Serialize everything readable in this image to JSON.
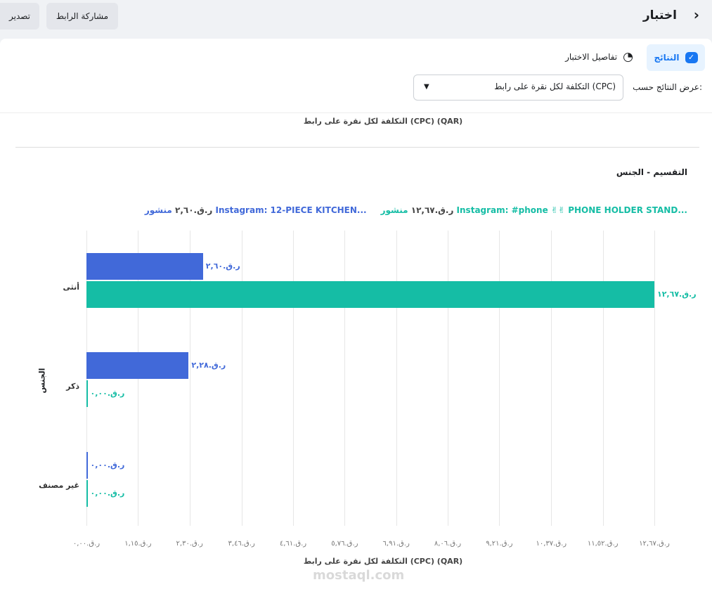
{
  "header": {
    "title": "اختبار",
    "share_label": "مشاركة الرابط",
    "export_label": "تصدير"
  },
  "tabs": [
    {
      "label": "النتائج",
      "active": true
    },
    {
      "label": "تفاصيل الاختبار"
    }
  ],
  "view_by": {
    "label": "عرض النتائج حسب:",
    "value": "التكلفة لكل نقرة على رابط (CPC)"
  },
  "chart_top_title": "التكلفة لكل نقرة على رابط (CPC) (QAR)",
  "breakdown_title": "التقسيم - الجنس",
  "watermark": "mostaql.com",
  "colors": {
    "blue": "#4169d9",
    "teal": "#15bda5",
    "accent": "#1877f2"
  },
  "chart_data": {
    "type": "bar",
    "orientation": "horizontal",
    "xlabel": "التكلفة لكل نقرة على رابط (CPC) (QAR)",
    "ylabel": "الجنس",
    "xlim": [
      0,
      12.67
    ],
    "grid": true,
    "legend_position": "top",
    "categories": [
      "أنثى",
      "ذكر",
      "غير مصنف"
    ],
    "tick_labels": [
      "ر.ق.٠,٠٠",
      "ر.ق.١,١٥",
      "ر.ق.٢,٣٠",
      "ر.ق.٣,٤٦",
      "ر.ق.٤,٦١",
      "ر.ق.٥,٧٦",
      "ر.ق.٦,٩١",
      "ر.ق.٨,٠٦",
      "ر.ق.٩,٢١",
      "ر.ق.١٠,٣٧",
      "ر.ق.١١,٥٢",
      "ر.ق.١٢,٦٧"
    ],
    "ticks": [
      0,
      1.15,
      2.3,
      3.46,
      4.61,
      5.76,
      6.91,
      8.06,
      9.21,
      10.37,
      11.52,
      12.67
    ],
    "series": [
      {
        "name": "منشور Instagram: 12-PIECE KITCHEN...",
        "legend_value": "ر.ق.٢,٦٠",
        "color": "#4169d9",
        "values": [
          2.6,
          2.28,
          0
        ],
        "labels": [
          "ر.ق.٢,٦٠",
          "ر.ق.٢,٢٨",
          "ر.ق.٠,٠٠"
        ]
      },
      {
        "name": "منشور Instagram: #phone ✌✌ PHONE HOLDER STAND...",
        "legend_value": "ر.ق.١٢,٦٧",
        "color": "#15bda5",
        "values": [
          12.67,
          0,
          0
        ],
        "labels": [
          "ر.ق.١٢,٦٧",
          "ر.ق.٠,٠٠",
          "ر.ق.٠,٠٠"
        ]
      }
    ]
  }
}
